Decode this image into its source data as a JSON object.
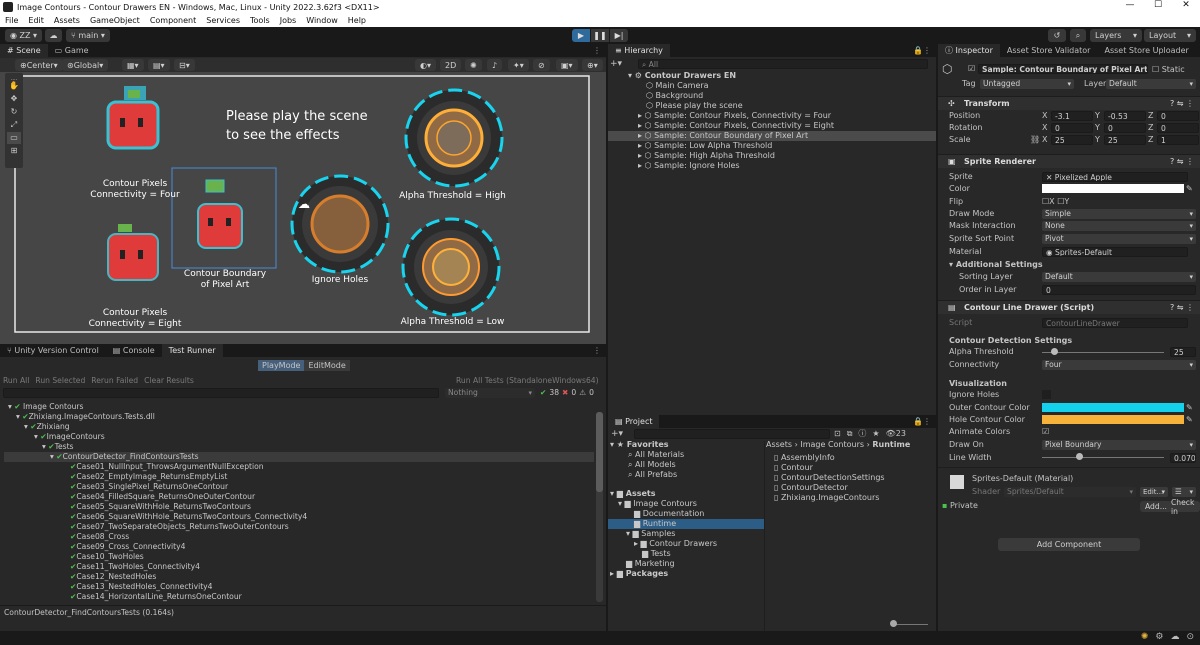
{
  "window": {
    "title": "Image Contours - Contour Drawers EN - Windows, Mac, Linux - Unity 2022.3.62f3 <DX11>"
  },
  "menu": [
    "File",
    "Edit",
    "Assets",
    "GameObject",
    "Component",
    "Services",
    "Tools",
    "Jobs",
    "Window",
    "Help"
  ],
  "toolbar": {
    "account": "ZZ",
    "branch": "main",
    "layers": "Layers",
    "layout": "Layout"
  },
  "scene": {
    "tabs": [
      "Scene",
      "Game"
    ],
    "pivot": "Center",
    "space": "Global",
    "mode2d": "2D",
    "message": [
      "Please play the scene",
      "to see the effects"
    ],
    "labels": {
      "four": [
        "Contour Pixels",
        "Connectivity = Four"
      ],
      "eight": [
        "Contour Pixels",
        "Connectivity = Eight"
      ],
      "boundary": [
        "Contour Boundary",
        "of Pixel Art"
      ],
      "holes": "Ignore Holes",
      "high": "Alpha Threshold = High",
      "low": "Alpha Threshold = Low"
    }
  },
  "hierarchy": {
    "tab": "Hierarchy",
    "search": "All",
    "root": "Contour Drawers EN",
    "items": [
      "Main Camera",
      "Background",
      "Please play the scene",
      "Sample: Contour Pixels, Connectivity = Four",
      "Sample: Contour Pixels, Connectivity = Eight",
      "Sample: Contour Boundary of Pixel Art",
      "Sample: Low Alpha Threshold",
      "Sample: High Alpha Threshold",
      "Sample: Ignore Holes"
    ]
  },
  "tests": {
    "tabs": [
      "Unity Version Control",
      "Console",
      "Test Runner"
    ],
    "modes": [
      "PlayMode",
      "EditMode"
    ],
    "actions": [
      "Run All",
      "Run Selected",
      "Rerun Failed",
      "Clear Results"
    ],
    "runall": "Run All Tests (StandaloneWindows64)",
    "filter": "Nothing",
    "pass": "38",
    "fail": "0",
    "skip": "0",
    "tree": [
      "Image Contours",
      "Zhixiang.ImageContours.Tests.dll",
      "Zhixiang",
      "ImageContours",
      "Tests",
      "ContourDetector_FindContoursTests"
    ],
    "cases": [
      "Case01_NullInput_ThrowsArgumentNullException",
      "Case02_EmptyImage_ReturnsEmptyList",
      "Case03_SinglePixel_ReturnsOneContour",
      "Case04_FilledSquare_ReturnsOneOuterContour",
      "Case05_SquareWithHole_ReturnsTwoContours",
      "Case06_SquareWithHole_ReturnsTwoContours_Connectivity4",
      "Case07_TwoSeparateObjects_ReturnsTwoOuterContours",
      "Case08_Cross",
      "Case09_Cross_Connectivity4",
      "Case10_TwoHoles",
      "Case11_TwoHoles_Connectivity4",
      "Case12_NestedHoles",
      "Case13_NestedHoles_Connectivity4",
      "Case14_HorizontalLine_ReturnsOneContour"
    ],
    "footer": "ContourDetector_FindContoursTests (0.164s)"
  },
  "project": {
    "tab": "Project",
    "count": "23",
    "favorites": "Favorites",
    "favitems": [
      "All Materials",
      "All Models",
      "All Prefabs"
    ],
    "assets": "Assets",
    "tree": [
      "Image Contours",
      "Documentation",
      "Runtime",
      "Samples",
      "Contour Drawers",
      "Tests",
      "Marketing"
    ],
    "packages": "Packages",
    "breadcrumb": [
      "Assets",
      "Image Contours",
      "Runtime"
    ],
    "files": [
      "AssemblyInfo",
      "Contour",
      "ContourDetectionSettings",
      "ContourDetector",
      "Zhixiang.ImageContours"
    ]
  },
  "inspector": {
    "tabs": [
      "Inspector",
      "Asset Store Validator",
      "Asset Store Uploader"
    ],
    "name": "Sample: Contour Boundary of Pixel Art",
    "static": "Static",
    "tag_label": "Tag",
    "tag": "Untagged",
    "layer_label": "Layer",
    "layer": "Default",
    "transform": {
      "title": "Transform",
      "position": [
        "-3.1",
        "-0.53",
        "0"
      ],
      "rotation": [
        "0",
        "0",
        "0"
      ],
      "scale": [
        "25",
        "25",
        "1"
      ],
      "labels": [
        "Position",
        "Rotation",
        "Scale"
      ]
    },
    "sprite": {
      "title": "Sprite Renderer",
      "fields": [
        "Sprite",
        "Color",
        "Flip",
        "Draw Mode",
        "Mask Interaction",
        "Sprite Sort Point",
        "Material"
      ],
      "sprite": "Pixelized Apple",
      "draw": "Simple",
      "mask": "None",
      "sort": "Pivot",
      "material": "Sprites-Default",
      "additional": "Additional Settings",
      "sorting_layer_label": "Sorting Layer",
      "sorting_layer": "Default",
      "order_label": "Order in Layer",
      "order": "0"
    },
    "script": {
      "title": "Contour Line Drawer (Script)",
      "script_label": "Script",
      "script": "ContourLineDrawer",
      "settings": "Contour Detection Settings",
      "alpha_label": "Alpha Threshold",
      "alpha": "25",
      "alpha_fraction": 0.1,
      "conn_label": "Connectivity",
      "conn": "Four",
      "vis": "Visualization",
      "holes_label": "Ignore Holes",
      "outer_label": "Outer Contour Color",
      "outer": "#14d2ec",
      "hole_label": "Hole Contour Color",
      "hole": "#f7b23a",
      "anim_label": "Animate Colors",
      "drawon_label": "Draw On",
      "drawon": "Pixel Boundary",
      "width_label": "Line Width",
      "width": "0.0704",
      "width_fraction": 0.3
    },
    "material": {
      "name": "Sprites-Default (Material)",
      "shader_label": "Shader",
      "shader": "Sprites/Default",
      "edit": "Edit...",
      "private": "Private",
      "add": "Add...",
      "checkin": "Check in"
    },
    "addcomp": "Add Component"
  }
}
